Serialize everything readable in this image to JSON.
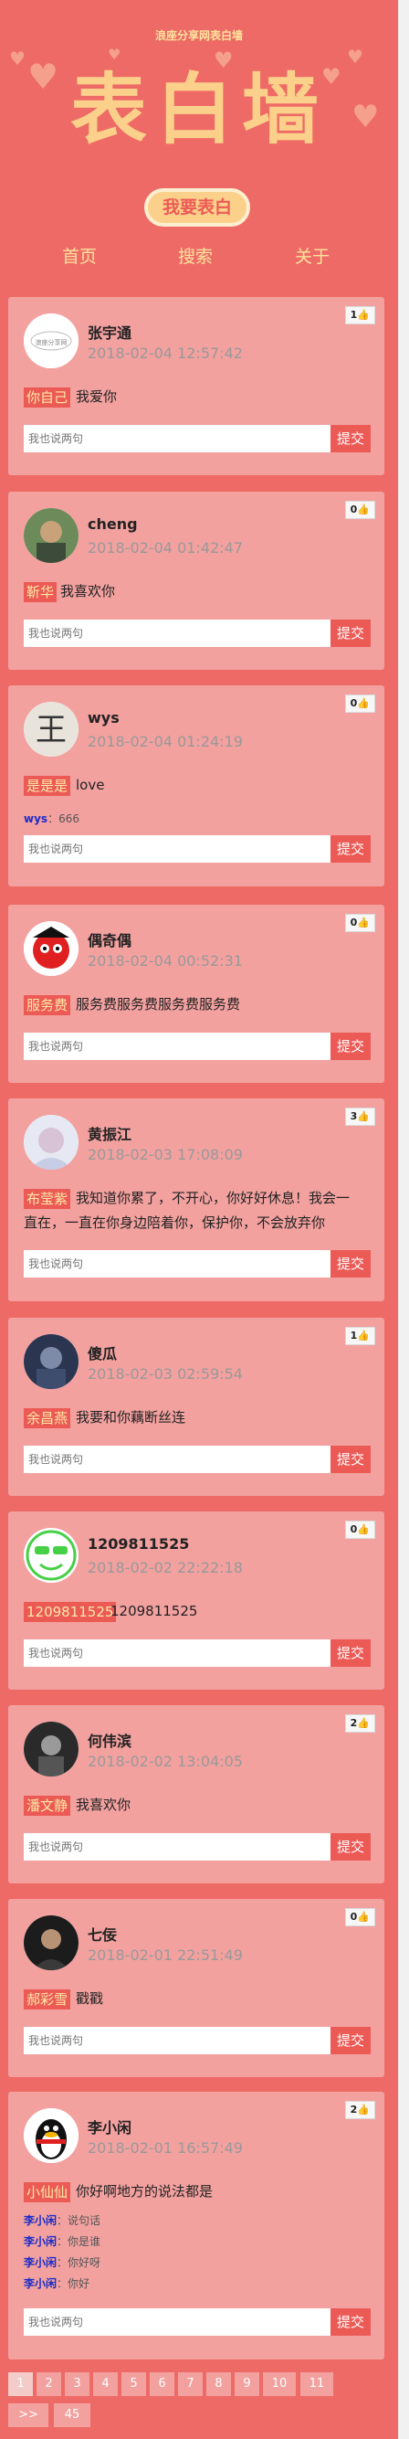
{
  "site": {
    "name": "浪座分享网表白墙",
    "title": "表白墙",
    "confess_button": "我要表白"
  },
  "nav": {
    "items": [
      "首页",
      "搜索",
      "关于"
    ]
  },
  "form": {
    "placeholder": "我也说两句",
    "submit_label": "提交"
  },
  "posts": [
    {
      "user": "张宇通",
      "time": "2018-02-04 12:57:42",
      "likes": "1",
      "to": "你自己",
      "message": "我爱你",
      "comments": []
    },
    {
      "user": "cheng",
      "time": "2018-02-04 01:42:47",
      "likes": "0",
      "to": "靳华",
      "message": "我喜欢你",
      "comments": []
    },
    {
      "user": "wys",
      "time": "2018-02-04 01:24:19",
      "likes": "0",
      "to": "是是是",
      "message": "love",
      "comments": [
        {
          "user": "wys",
          "text": "：666"
        }
      ]
    },
    {
      "user": "偶奇偶",
      "time": "2018-02-04 00:52:31",
      "likes": "0",
      "to": "服务费",
      "message": "服务费服务费服务费服务费",
      "comments": []
    },
    {
      "user": "黄振江",
      "time": "2018-02-03 17:08:09",
      "likes": "3",
      "to": "布莹紫",
      "message_line1": "我知道你累了，不开心，你好好休息！我会一",
      "message_line2": "直在，一直在你身边陪着你，保护你，不会放弃你",
      "comments": []
    },
    {
      "user": "傻瓜",
      "time": "2018-02-03 02:59:54",
      "likes": "1",
      "to": "余昌燕",
      "message": "我要和你藕断丝连",
      "comments": []
    },
    {
      "user": "1209811525",
      "time": "2018-02-02 22:22:18",
      "likes": "0",
      "to": "1209811525",
      "message": "1209811525",
      "comments": []
    },
    {
      "user": "何伟滨",
      "time": "2018-02-02 13:04:05",
      "likes": "2",
      "to": "潘文静",
      "message": "我喜欢你",
      "comments": []
    },
    {
      "user": "七佞",
      "time": "2018-02-01 22:51:49",
      "likes": "0",
      "to": "郝彩雪",
      "message": "戳戳",
      "comments": []
    },
    {
      "user": "李小闲",
      "time": "2018-02-01 16:57:49",
      "likes": "2",
      "to": "小仙仙",
      "message": "你好啊地方的说法都是",
      "comments": [
        {
          "user": "李小闲",
          "text": "：说句话"
        },
        {
          "user": "李小闲",
          "text": "：你是谁"
        },
        {
          "user": "李小闲",
          "text": "：你好呀"
        },
        {
          "user": "李小闲",
          "text": "：你好"
        }
      ]
    }
  ],
  "pagination": {
    "pages": [
      "1",
      "2",
      "3",
      "4",
      "5",
      "6",
      "7",
      "8",
      "9",
      "10",
      "11"
    ],
    "next": ">>",
    "last": "45",
    "current": "1"
  },
  "colors": {
    "background": "#ee6a66",
    "card": "#f2a19f",
    "accent": "#ec5a56",
    "title": "#fbd08a"
  }
}
